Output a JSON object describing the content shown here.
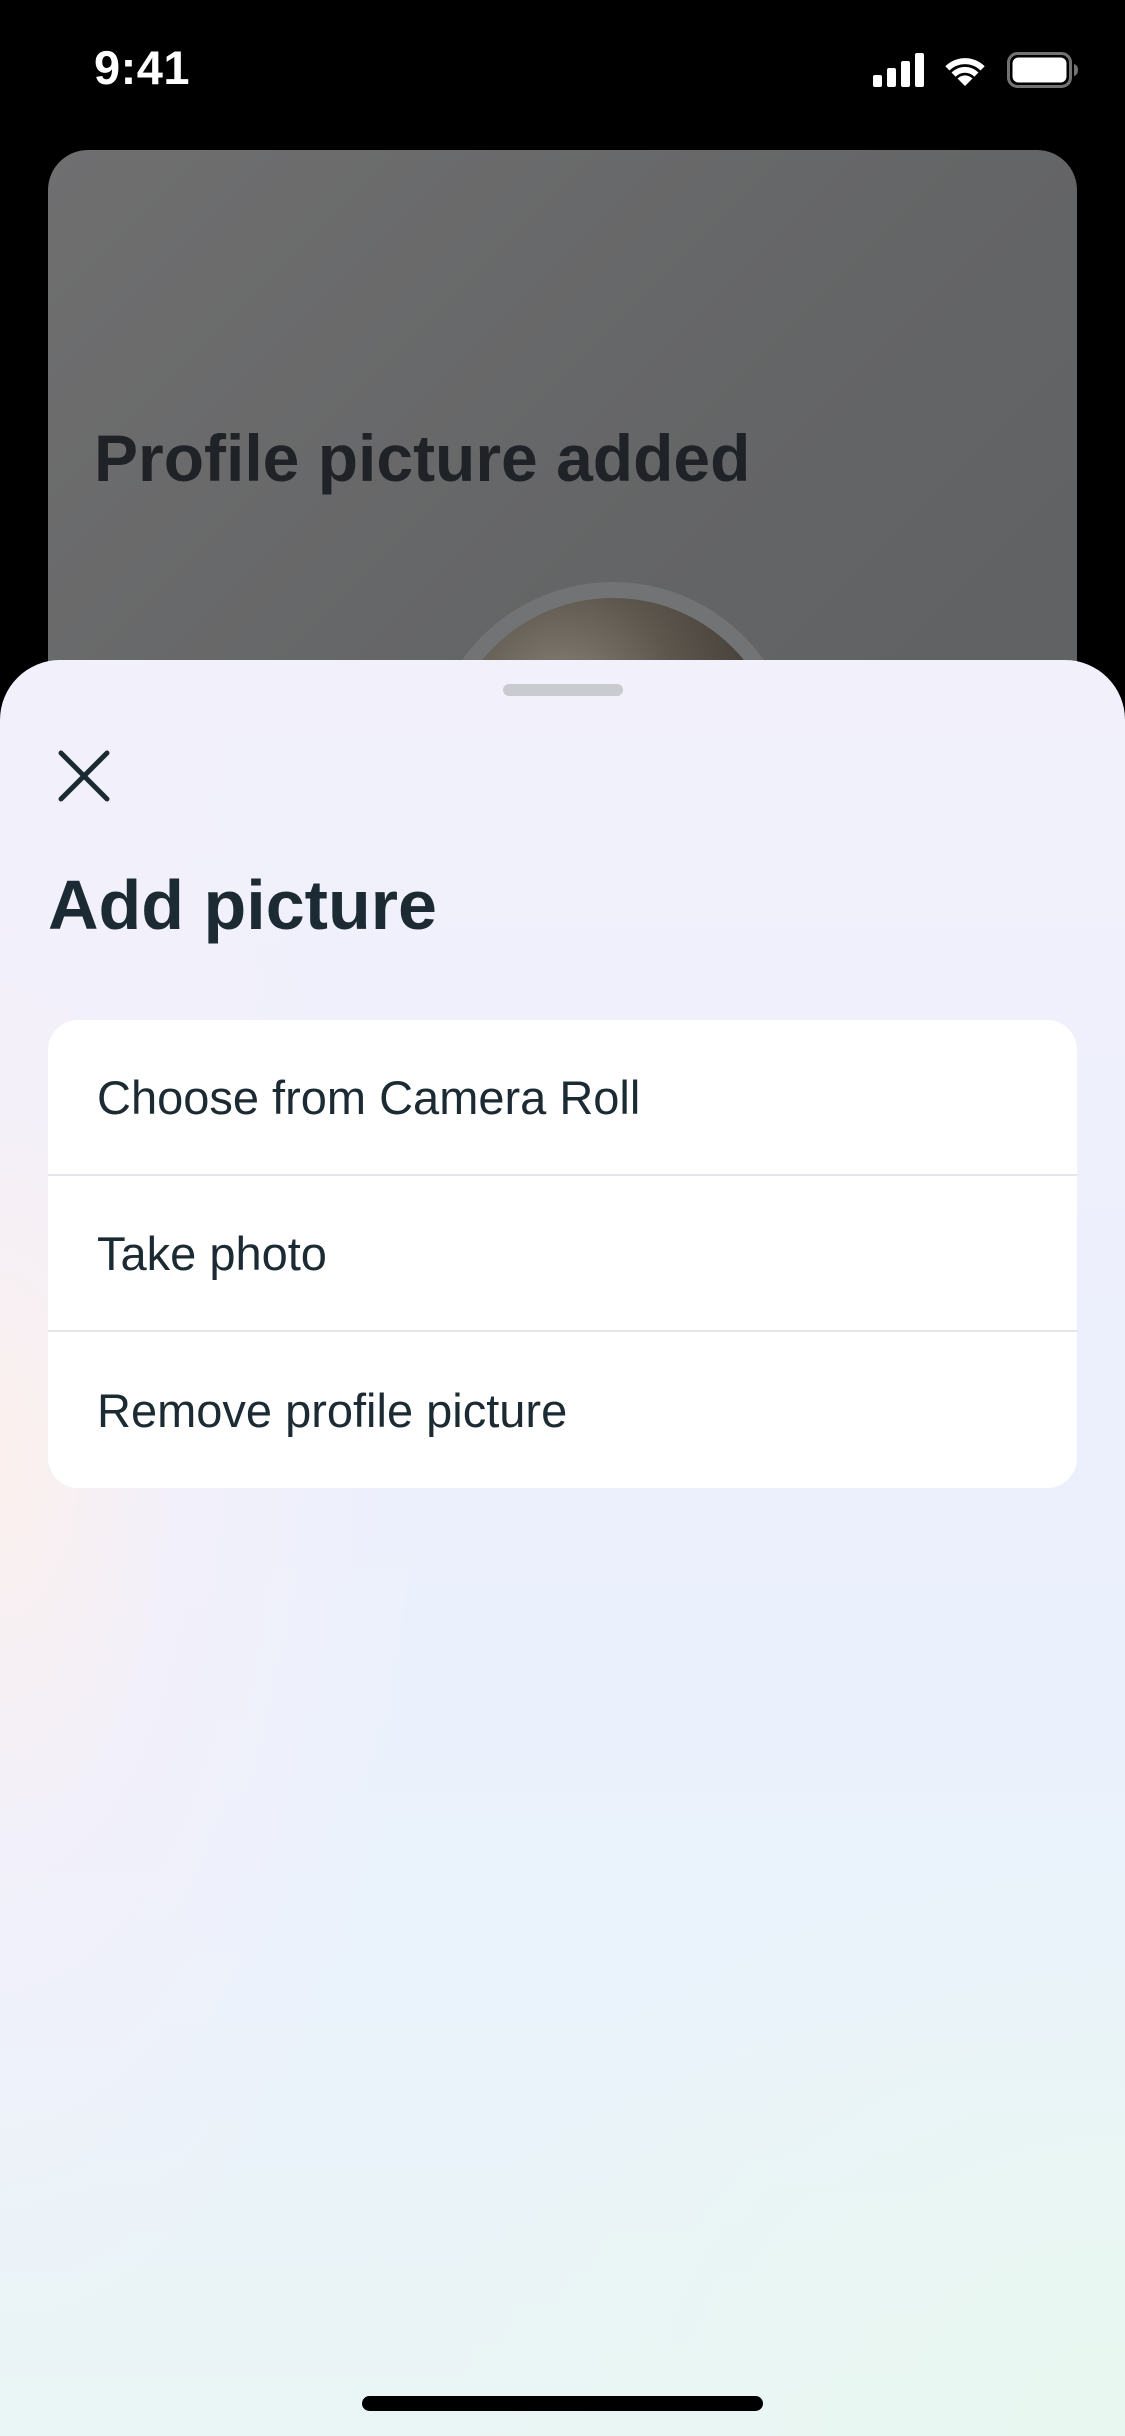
{
  "status_bar": {
    "time": "9:41",
    "icons": [
      "cellular-signal-icon",
      "wifi-icon",
      "battery-icon"
    ]
  },
  "background_screen": {
    "card_title": "Profile picture added"
  },
  "sheet": {
    "close_icon": "close-icon",
    "title": "Add picture",
    "options": [
      {
        "label": "Choose from Camera Roll"
      },
      {
        "label": "Take photo"
      },
      {
        "label": "Remove profile picture"
      }
    ]
  },
  "colors": {
    "text_primary": "#1c2b33",
    "divider": "#e4e6ea",
    "card_background": "#ffffff",
    "scrim_card": "#646566"
  }
}
